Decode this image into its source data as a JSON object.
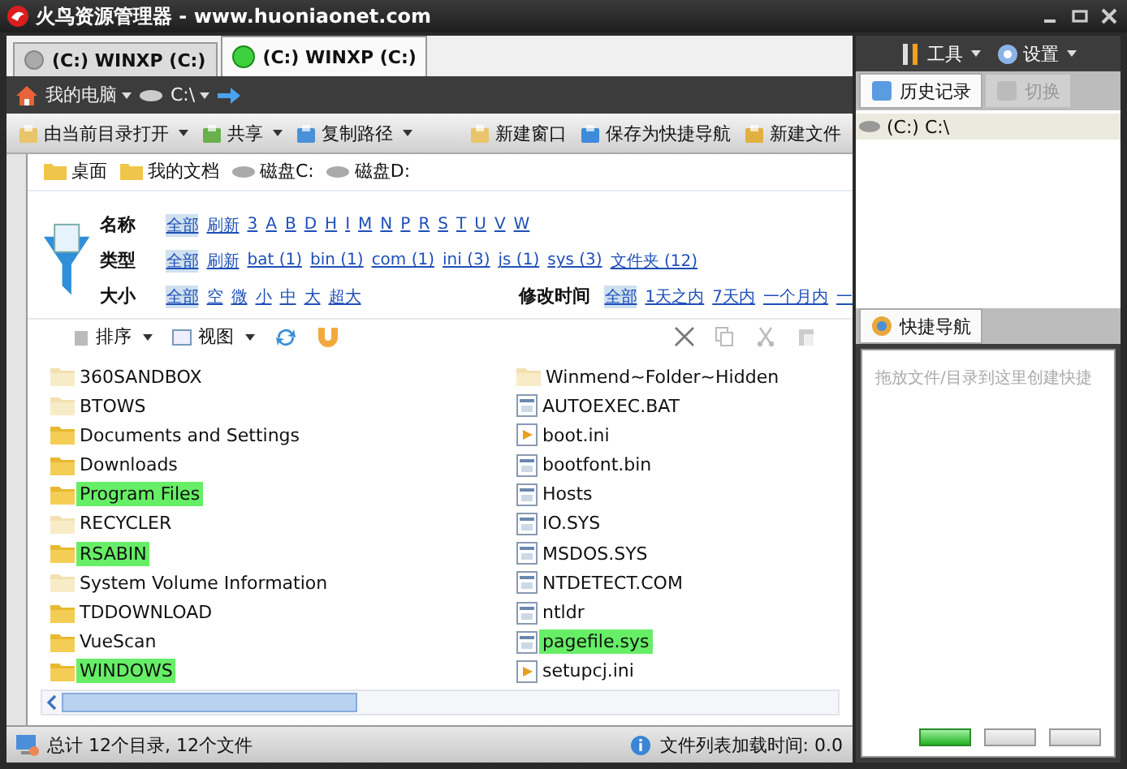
{
  "window": {
    "title": "火鸟资源管理器 - www.huoniaonet.com"
  },
  "tabs": [
    {
      "label": "(C:) WINXP (C:)",
      "selected": false
    },
    {
      "label": "(C:) WINXP (C:)",
      "selected": true
    }
  ],
  "address": {
    "location": "我的电脑",
    "drive": "C:\\"
  },
  "toolbar": [
    {
      "label": "由当前目录打开",
      "dropdown": true
    },
    {
      "label": "共享",
      "dropdown": true
    },
    {
      "label": "复制路径",
      "dropdown": true
    },
    {
      "label": "新建窗口",
      "dropdown": false
    },
    {
      "label": "保存为快捷导航",
      "dropdown": false
    },
    {
      "label": "新建文件",
      "dropdown": false
    }
  ],
  "bookmarks": [
    {
      "label": "桌面",
      "kind": "folder"
    },
    {
      "label": "我的文档",
      "kind": "folder"
    },
    {
      "label": "磁盘C:",
      "kind": "drive"
    },
    {
      "label": "磁盘D:",
      "kind": "drive"
    }
  ],
  "filters": [
    {
      "label": "名称",
      "options": [
        {
          "label": "全部",
          "selected": true
        },
        {
          "label": "刷新",
          "selected": false
        },
        {
          "label": "3",
          "selected": false
        },
        {
          "label": "A",
          "selected": false
        },
        {
          "label": "B",
          "selected": false
        },
        {
          "label": "D",
          "selected": false
        },
        {
          "label": "H",
          "selected": false
        },
        {
          "label": "I",
          "selected": false
        },
        {
          "label": "M",
          "selected": false
        },
        {
          "label": "N",
          "selected": false
        },
        {
          "label": "P",
          "selected": false
        },
        {
          "label": "R",
          "selected": false
        },
        {
          "label": "S",
          "selected": false
        },
        {
          "label": "T",
          "selected": false
        },
        {
          "label": "U",
          "selected": false
        },
        {
          "label": "V",
          "selected": false
        },
        {
          "label": "W",
          "selected": false
        }
      ]
    },
    {
      "label": "类型",
      "options": [
        {
          "label": "全部",
          "selected": true
        },
        {
          "label": "刷新",
          "selected": false
        },
        {
          "label": "bat (1)",
          "selected": false
        },
        {
          "label": "bin (1)",
          "selected": false
        },
        {
          "label": "com (1)",
          "selected": false
        },
        {
          "label": "ini (3)",
          "selected": false
        },
        {
          "label": "js (1)",
          "selected": false
        },
        {
          "label": "sys (3)",
          "selected": false
        },
        {
          "label": "文件夹 (12)",
          "selected": false
        }
      ]
    },
    {
      "label": "大小",
      "options": [
        {
          "label": "全部",
          "selected": true
        },
        {
          "label": "空",
          "selected": false
        },
        {
          "label": "微",
          "selected": false
        },
        {
          "label": "小",
          "selected": false
        },
        {
          "label": "中",
          "selected": false
        },
        {
          "label": "大",
          "selected": false
        },
        {
          "label": "超大",
          "selected": false
        }
      ]
    }
  ],
  "time_filter": {
    "label": "修改时间",
    "options": [
      {
        "label": "全部",
        "selected": true
      },
      {
        "label": "1天之内",
        "selected": false
      },
      {
        "label": "7天内",
        "selected": false
      },
      {
        "label": "一个月内",
        "selected": false
      },
      {
        "label": "一",
        "selected": false
      }
    ]
  },
  "view_toolbar": {
    "sort": "排序",
    "view": "视图"
  },
  "columns": [
    [
      {
        "name": "360SANDBOX",
        "kind": "folder",
        "hidden": true,
        "highlighted": false
      },
      {
        "name": "BTOWS",
        "kind": "folder",
        "hidden": true,
        "highlighted": false
      },
      {
        "name": "Documents and Settings",
        "kind": "folder",
        "hidden": false,
        "highlighted": false
      },
      {
        "name": "Downloads",
        "kind": "folder",
        "hidden": false,
        "highlighted": false
      },
      {
        "name": "Program Files",
        "kind": "folder",
        "hidden": false,
        "highlighted": true
      },
      {
        "name": "RECYCLER",
        "kind": "folder",
        "hidden": true,
        "highlighted": false
      },
      {
        "name": "RSABIN",
        "kind": "folder",
        "hidden": false,
        "highlighted": true
      },
      {
        "name": "System Volume Information",
        "kind": "folder",
        "hidden": true,
        "highlighted": false
      },
      {
        "name": "TDDOWNLOAD",
        "kind": "folder",
        "hidden": false,
        "highlighted": false
      },
      {
        "name": "VueScan",
        "kind": "folder",
        "hidden": false,
        "highlighted": false
      },
      {
        "name": "WINDOWS",
        "kind": "folder",
        "hidden": false,
        "highlighted": true
      }
    ],
    [
      {
        "name": "Winmend~Folder~Hidden",
        "kind": "folder",
        "hidden": true,
        "highlighted": false
      },
      {
        "name": "AUTOEXEC.BAT",
        "kind": "file",
        "hidden": false,
        "highlighted": false
      },
      {
        "name": "boot.ini",
        "kind": "settings",
        "hidden": false,
        "highlighted": false
      },
      {
        "name": "bootfont.bin",
        "kind": "file",
        "hidden": false,
        "highlighted": false
      },
      {
        "name": "Hosts",
        "kind": "file",
        "hidden": false,
        "highlighted": false
      },
      {
        "name": "IO.SYS",
        "kind": "file",
        "hidden": false,
        "highlighted": false
      },
      {
        "name": "MSDOS.SYS",
        "kind": "file",
        "hidden": false,
        "highlighted": false
      },
      {
        "name": "NTDETECT.COM",
        "kind": "file",
        "hidden": false,
        "highlighted": false
      },
      {
        "name": "ntldr",
        "kind": "file",
        "hidden": false,
        "highlighted": false
      },
      {
        "name": "pagefile.sys",
        "kind": "file",
        "hidden": false,
        "highlighted": true
      },
      {
        "name": "setupcj.ini",
        "kind": "settings",
        "hidden": false,
        "highlighted": false
      }
    ]
  ],
  "status_bar": {
    "summary": "总计 12个目录, 12个文件",
    "load_time": "文件列表加载时间: 0.0"
  },
  "side_panel": {
    "menus": [
      {
        "label": "工具"
      },
      {
        "label": "设置"
      }
    ],
    "tabs": [
      {
        "label": "历史记录",
        "selected": true,
        "disabled": false
      },
      {
        "label": "切换",
        "selected": false,
        "disabled": true
      }
    ],
    "history": [
      {
        "label": "(C:)  C:\\",
        "selected": true
      }
    ],
    "quick_nav": {
      "title": "快捷导航",
      "hint": "拖放文件/目录到这里创建快捷"
    },
    "buttons": [
      {
        "selected": true
      },
      {
        "selected": false
      },
      {
        "selected": false
      }
    ]
  }
}
